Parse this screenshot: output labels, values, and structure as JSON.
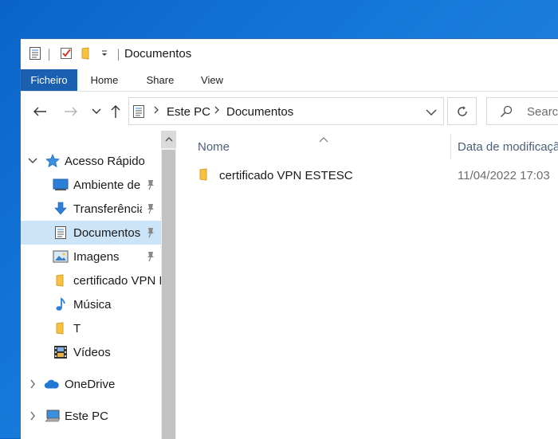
{
  "window": {
    "title": "Documentos"
  },
  "quick_access_toolbar": {
    "icons": [
      "properties-icon",
      "checkmark-icon",
      "new-folder-icon",
      "customize-dropdown-icon"
    ]
  },
  "ribbon": {
    "tabs": [
      {
        "label": "Ficheiro",
        "active": true
      },
      {
        "label": "Home"
      },
      {
        "label": "Share"
      },
      {
        "label": "View"
      }
    ]
  },
  "address_bar": {
    "breadcrumbs": [
      "Este PC",
      "Documentos"
    ]
  },
  "search": {
    "placeholder": "Search"
  },
  "sidebar": {
    "items": [
      {
        "label": "Acesso Rápido",
        "icon": "star-icon",
        "expanded": true
      },
      {
        "label": "Ambiente de trabalho",
        "icon": "desktop-icon",
        "pinned": true
      },
      {
        "label": "Transferências",
        "icon": "download-icon",
        "pinned": true
      },
      {
        "label": "Documentos",
        "icon": "document-icon",
        "pinned": true,
        "selected": true
      },
      {
        "label": "Imagens",
        "icon": "pictures-icon",
        "pinned": true
      },
      {
        "label": "certificado VPN ESTESC",
        "icon": "folder-icon"
      },
      {
        "label": "Música",
        "icon": "music-icon"
      },
      {
        "label": "T",
        "icon": "folder-icon"
      },
      {
        "label": "Vídeos",
        "icon": "videos-icon"
      },
      {
        "label": "OneDrive",
        "icon": "cloud-icon",
        "expanded": false
      },
      {
        "label": "Este PC",
        "icon": "computer-icon",
        "expanded": false
      }
    ]
  },
  "file_list": {
    "columns": [
      "Nome",
      "Data de modificação"
    ],
    "rows": [
      {
        "name": "certificado VPN ESTESC",
        "modified": "11/04/2022 17:03",
        "type": "folder"
      }
    ]
  },
  "colors": {
    "accent": "#1a5fb0",
    "selection": "#cce4f7",
    "folder": "#f5c242"
  }
}
